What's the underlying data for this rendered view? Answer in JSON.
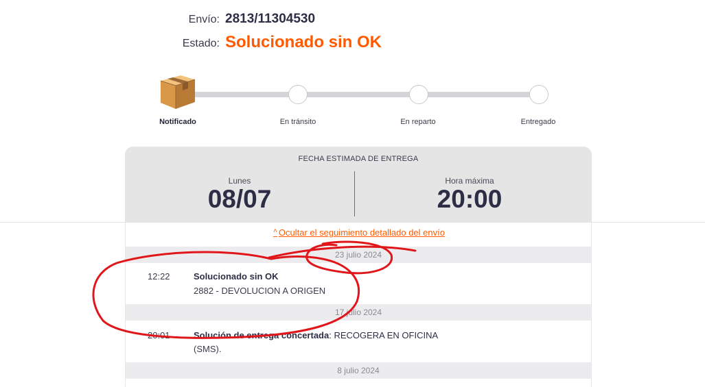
{
  "header": {
    "envio_label": "Envío:",
    "envio_value": "2813/11304530",
    "estado_label": "Estado:",
    "estado_value": "Solucionado sin OK"
  },
  "progress": {
    "steps": [
      {
        "label": "Notificado",
        "active": true,
        "icon": "package-box-icon"
      },
      {
        "label": "En tránsito",
        "active": false
      },
      {
        "label": "En reparto",
        "active": false
      },
      {
        "label": "Entregado",
        "active": false
      }
    ]
  },
  "estimate": {
    "title": "FECHA ESTIMADA DE ENTREGA",
    "day_label": "Lunes",
    "date": "08/07",
    "time_label": "Hora máxima",
    "time": "20:00"
  },
  "detail": {
    "toggle_chevron": "˄",
    "toggle_label": "Ocultar el seguimiento detallado del envío",
    "groups": [
      {
        "date": "23 julio 2024",
        "events": [
          {
            "time": "12:22",
            "title": "Solucionado sin OK",
            "title_suffix": "",
            "desc": "2882 - DEVOLUCION A ORIGEN"
          }
        ]
      },
      {
        "date": "17 julio 2024",
        "events": [
          {
            "time": "20:01",
            "title": "Solución de entrega concertada",
            "title_suffix": ": RECOGERA EN OFICINA",
            "desc": "(SMS)."
          }
        ]
      },
      {
        "date": "8 julio 2024",
        "events": []
      }
    ]
  },
  "colors": {
    "accent": "#ff5a00",
    "text_dark": "#2b2e45",
    "panel_bg": "#e5e5e6",
    "annotation": "#e0161b"
  }
}
